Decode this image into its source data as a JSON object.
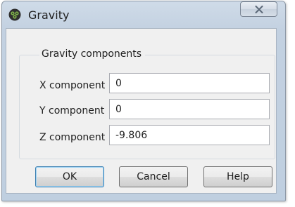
{
  "window": {
    "title": "Gravity",
    "icon": "app-logo-icon",
    "close_icon": "close-icon"
  },
  "group": {
    "title": "Gravity components",
    "rows": [
      {
        "label": "X component",
        "value": "0"
      },
      {
        "label": "Y component",
        "value": "0"
      },
      {
        "label": "Z component",
        "value": "-9.806"
      }
    ]
  },
  "buttons": {
    "ok": "OK",
    "cancel": "Cancel",
    "help": "Help"
  },
  "colors": {
    "titlebar": "#c3d1e1",
    "client": "#f0f0f0",
    "default_button_border": "#3c7fb1"
  }
}
